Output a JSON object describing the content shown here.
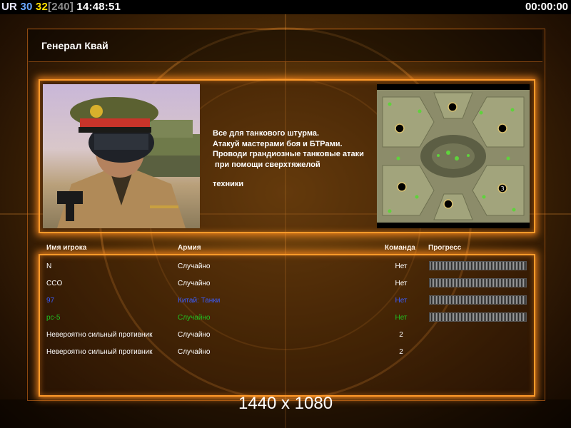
{
  "hud": {
    "ur": "UR",
    "a": "30",
    "b": "32",
    "c": "[240]",
    "clock": "14:48:51",
    "timer": "00:00:00"
  },
  "title": "Генерал Квай",
  "description": [
    "Все для танкового штурма.",
    "Атакуй мастерами боя и БТРами.",
    "Проводи грандиозные танковые атаки",
    " при помощи сверхтяжелой",
    "",
    "техники"
  ],
  "table": {
    "headers": {
      "name": "Имя игрока",
      "army": "Армия",
      "team": "Команда",
      "progress": "Прогресс"
    },
    "rows": [
      {
        "name": "N",
        "army": "Случайно",
        "team": "Нет",
        "color": "#ffffff",
        "progress": 0,
        "show_bar": true
      },
      {
        "name": "CCO",
        "army": "Случайно",
        "team": "Нет",
        "color": "#ffffff",
        "progress": 0,
        "show_bar": true
      },
      {
        "name": "97",
        "army": "Китай: Танки",
        "team": "Нет",
        "color": "#3a5cff",
        "progress": 0,
        "show_bar": true
      },
      {
        "name": "pc-5",
        "army": "Случайно",
        "team": "Нет",
        "color": "#20c020",
        "progress": 0,
        "show_bar": true
      },
      {
        "name": "Невероятно сильный противник",
        "army": "Случайно",
        "team": "2",
        "color": "#ffffff",
        "progress": 0,
        "show_bar": false
      },
      {
        "name": "Невероятно сильный противник",
        "army": "Случайно",
        "team": "2",
        "color": "#ffffff",
        "progress": 0,
        "show_bar": false
      }
    ]
  },
  "minimap": {
    "marker_label": "3"
  },
  "resolution": "1440 x 1080"
}
